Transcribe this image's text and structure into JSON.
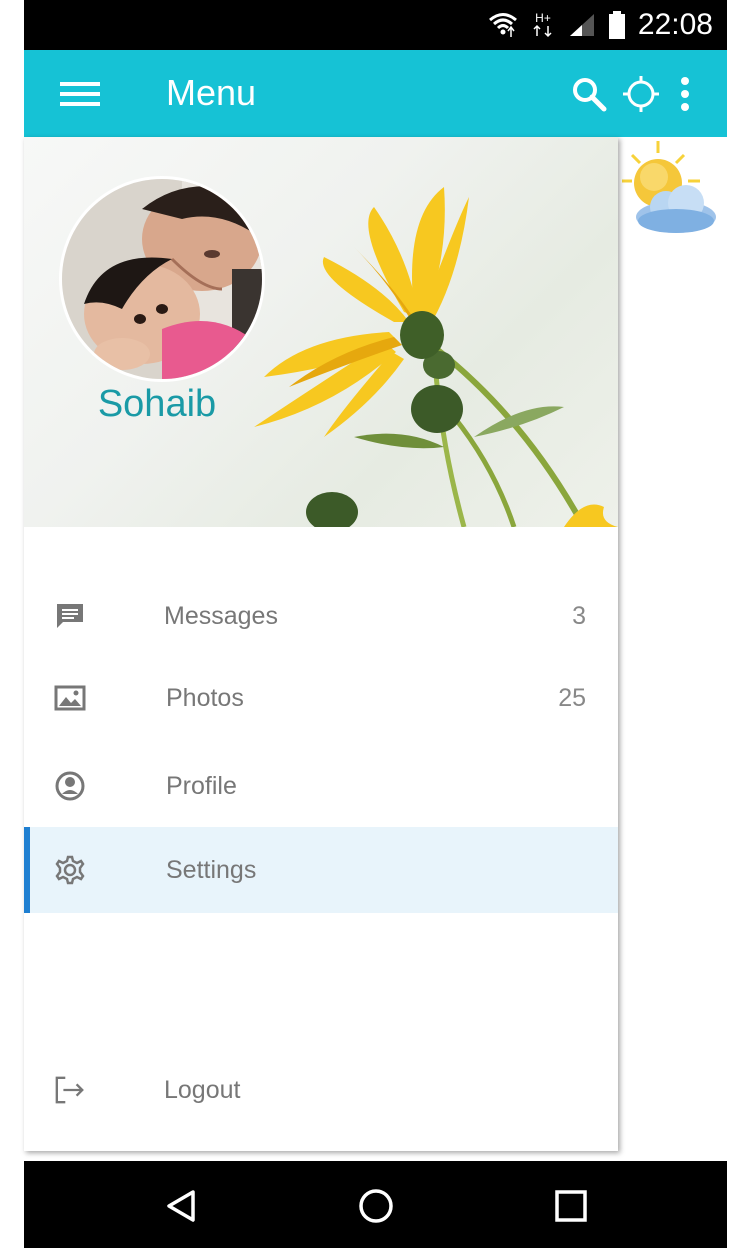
{
  "status_bar": {
    "time": "22:08",
    "network_label": "H+"
  },
  "app_bar": {
    "title": "Menu",
    "accent_color": "#16c2d5"
  },
  "drawer": {
    "user_name": "Sohaib",
    "menu_items": [
      {
        "label": "Messages",
        "count": "3",
        "icon": "message-icon",
        "active": false
      },
      {
        "label": "Photos",
        "count": "25",
        "icon": "image-icon",
        "active": false
      },
      {
        "label": "Profile",
        "count": "",
        "icon": "account-circle-icon",
        "active": false
      },
      {
        "label": "Settings",
        "count": "",
        "icon": "gear-icon",
        "active": true
      }
    ],
    "logout_label": "Logout"
  },
  "colors": {
    "selected_item_bg": "#e8f4fb",
    "selected_indicator": "#1f7fd1",
    "user_name": "#1a9aa6"
  }
}
